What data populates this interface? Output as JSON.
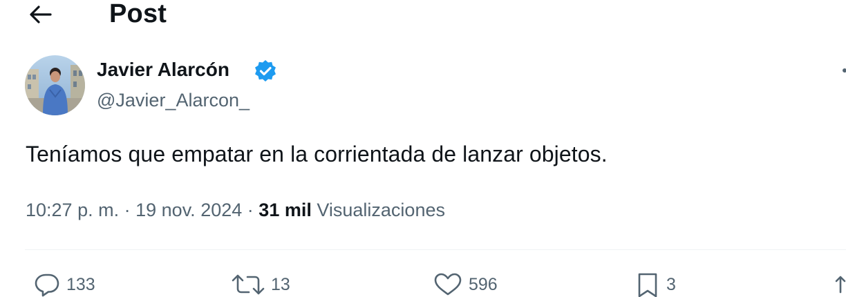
{
  "header": {
    "title": "Post"
  },
  "post": {
    "author": {
      "display_name": "Javier Alarcón",
      "handle": "@Javier_Alarcon_",
      "verified": true
    },
    "text": "Teníamos que empatar en la corrientada de lanzar objetos.",
    "time": "10:27 p. m.",
    "date": "19 nov. 2024",
    "separator": "·",
    "views_count": "31 mil",
    "views_label": "Visualizaciones"
  },
  "actions": {
    "replies": "133",
    "reposts": "13",
    "likes": "596",
    "bookmarks": "3"
  },
  "colors": {
    "text_primary": "#0f1419",
    "text_secondary": "#536471",
    "verified_blue": "#1d9bf0",
    "divider": "#eff3f4"
  },
  "icons": {
    "back": "arrow-left-icon",
    "verified": "verified-badge-icon",
    "reply": "speech-bubble-icon",
    "repost": "repost-arrows-icon",
    "like": "heart-icon",
    "bookmark": "bookmark-icon",
    "share": "share-icon"
  }
}
